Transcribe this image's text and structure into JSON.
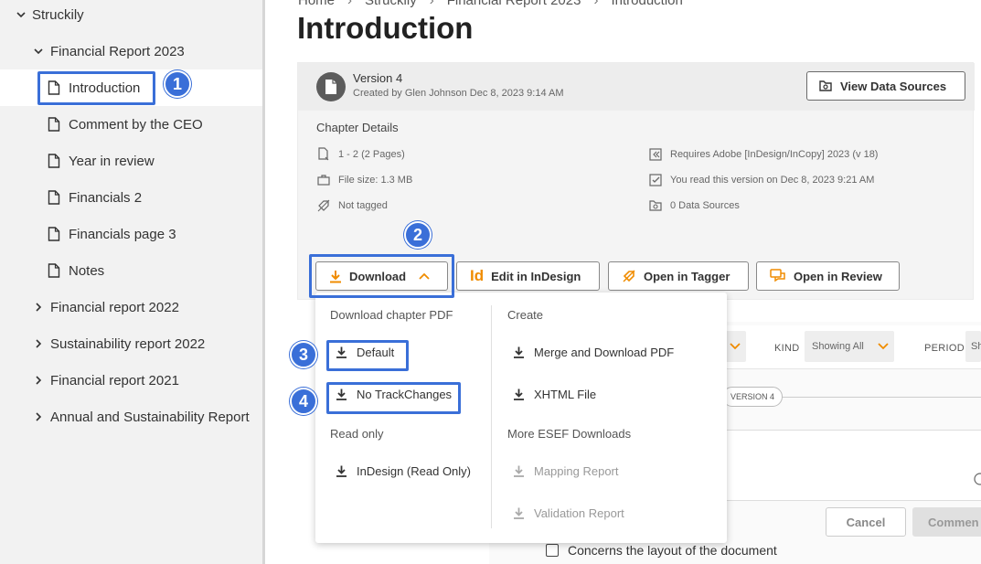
{
  "sidebar": {
    "root": "Struckily",
    "items": [
      {
        "label": "Financial Report 2023",
        "type": "folder",
        "expanded": true
      },
      {
        "label": "Introduction",
        "type": "doc",
        "selected": true
      },
      {
        "label": "Comment by the CEO",
        "type": "doc"
      },
      {
        "label": "Year in review",
        "type": "doc"
      },
      {
        "label": "Financials 2",
        "type": "doc"
      },
      {
        "label": "Financials page 3",
        "type": "doc"
      },
      {
        "label": "Notes",
        "type": "doc"
      },
      {
        "label": "Financial report 2022",
        "type": "folder"
      },
      {
        "label": "Sustainability report 2022",
        "type": "folder"
      },
      {
        "label": "Financial report 2021",
        "type": "folder"
      },
      {
        "label": "Annual and Sustainability Report",
        "type": "folder"
      }
    ]
  },
  "breadcrumb": [
    "Home",
    "Struckily",
    "Financial Report 2023",
    "Introduction"
  ],
  "page_title": "Introduction",
  "version": {
    "title": "Version 4",
    "created": "Created by Glen Johnson Dec 8, 2023 9:14 AM",
    "view_sources_label": "View Data Sources"
  },
  "chapter_details": {
    "heading": "Chapter Details",
    "pages": "1 - 2 (2 Pages)",
    "file_size": "File size: 1.3 MB",
    "tagged": "Not tagged",
    "requires": "Requires Adobe [InDesign/InCopy] 2023 (v 18)",
    "read": "You read this version on Dec 8, 2023 9:21 AM",
    "data_sources": "0 Data Sources"
  },
  "actions": {
    "download": "Download",
    "edit": "Edit in InDesign",
    "tagger": "Open in Tagger",
    "review": "Open in Review"
  },
  "dropdown": {
    "left_heading": "Download chapter PDF",
    "default": "Default",
    "no_track": "No TrackChanges",
    "read_only_heading": "Read only",
    "indesign_ro": "InDesign (Read Only)",
    "create_heading": "Create",
    "merge": "Merge and Download PDF",
    "xhtml": "XHTML File",
    "esef_heading": "More ESEF Downloads",
    "mapping": "Mapping Report",
    "validation": "Validation Report"
  },
  "background": {
    "kind_label": "KIND",
    "kind_value": "Showing All",
    "period_label": "PERIOD",
    "period_value": "Sh",
    "version_pill": "VERSION 4",
    "cancel": "Cancel",
    "comment": "Commen",
    "checkbox_label": "Concerns the layout of the document"
  },
  "annotations": [
    "1",
    "2",
    "3",
    "4"
  ],
  "colors": {
    "accent_blue": "#3a6fd8",
    "orange": "#f08c00"
  }
}
